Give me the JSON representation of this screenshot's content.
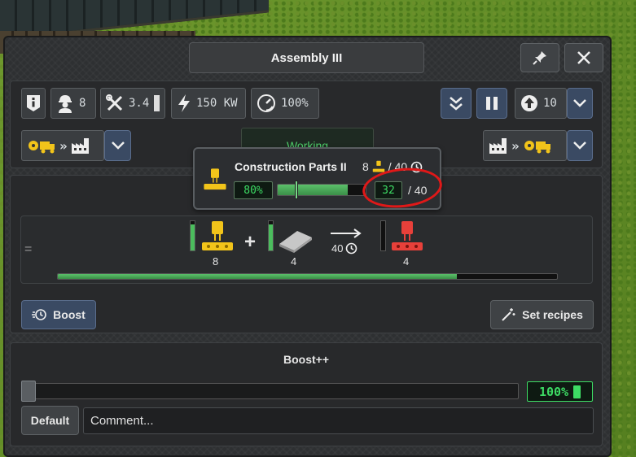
{
  "window": {
    "title": "Assembly III",
    "pin_icon": "pin-icon",
    "close_icon": "close-icon"
  },
  "stats": {
    "workers": "8",
    "maintenance": "3.4",
    "power": "150 KW",
    "efficiency": "100%",
    "priority": "10"
  },
  "status": "Working",
  "tooltip": {
    "title": "Construction Parts II",
    "rate": "8",
    "rate_total": "/ 40",
    "efficiency": "80%",
    "progress_value": "32",
    "progress_total": "/ 40",
    "progress_fraction": 0.8
  },
  "recipe": {
    "input1_qty": "8",
    "input1_fill": 0.9,
    "input2_qty": "4",
    "input2_fill": 0.9,
    "duration": "40",
    "output_qty": "4",
    "output_fill": 0.0,
    "progress_fraction": 0.8,
    "equals_symbol": "=",
    "plus_symbol": "+"
  },
  "buttons": {
    "boost": "Boost",
    "set_recipes": "Set recipes",
    "default": "Default"
  },
  "boostpp": {
    "title": "Boost++",
    "value": "100%",
    "fill": 0.0
  },
  "comment": {
    "placeholder": "Comment..."
  },
  "colors": {
    "accent_green": "#3ddc64",
    "input_icon": "#f2c41a",
    "output_icon": "#e8403a",
    "annotation": "#e01818"
  }
}
